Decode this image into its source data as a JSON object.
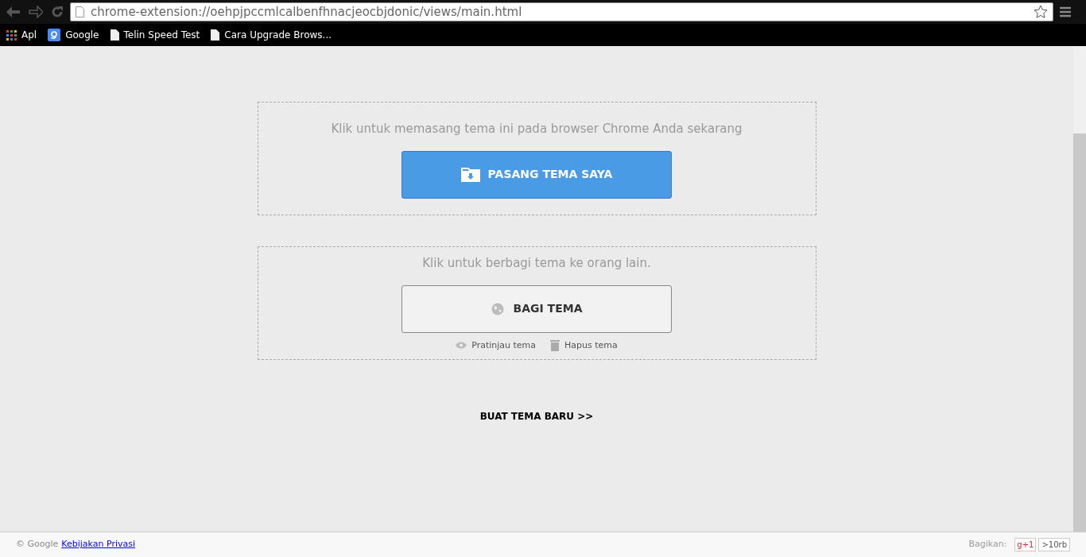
{
  "browser": {
    "url": "chrome-extension://oehpjpccmlcalbenfhnacjeocbjdonic/views/main.html",
    "bookmarks": [
      {
        "label": "Apl",
        "kind": "apps"
      },
      {
        "label": "Google",
        "kind": "google"
      },
      {
        "label": "Telin Speed Test",
        "kind": "page"
      },
      {
        "label": "Cara Upgrade Brows...",
        "kind": "page"
      }
    ]
  },
  "install": {
    "prompt": "Klik untuk memasang tema ini pada browser Chrome Anda sekarang",
    "button": "PASANG TEMA SAYA"
  },
  "share": {
    "prompt": "Klik untuk berbagi tema ke orang lain.",
    "button": "BAGI TEMA",
    "actions": [
      {
        "label": "Pratinjau tema",
        "kind": "preview"
      },
      {
        "label": "Hapus tema",
        "kind": "delete"
      }
    ]
  },
  "create_link": "BUAT TEMA BARU >>",
  "footer": {
    "copyright": "© Google",
    "privacy_link": "Kebijakan Privasi",
    "share_label": "Bagikan:",
    "gplus": "g+1",
    "count": ">10rb"
  }
}
